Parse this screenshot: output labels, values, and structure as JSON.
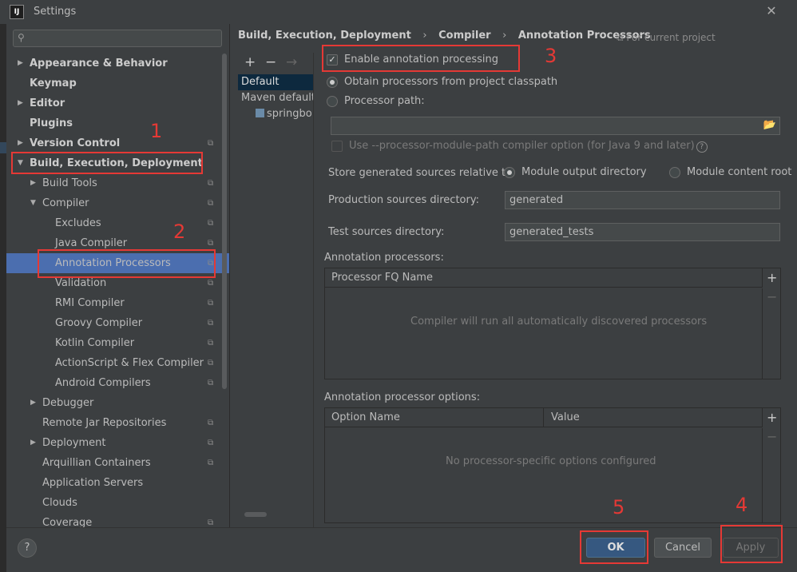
{
  "window": {
    "title": "Settings",
    "app_logo": "IJ"
  },
  "sidebar": {
    "search_placeholder": "",
    "items": [
      {
        "label": "Appearance & Behavior",
        "bold": true,
        "arrow": "right",
        "level": 0
      },
      {
        "label": "Keymap",
        "bold": true,
        "arrow": "",
        "level": 0
      },
      {
        "label": "Editor",
        "bold": true,
        "arrow": "right",
        "level": 0
      },
      {
        "label": "Plugins",
        "bold": true,
        "arrow": "",
        "level": 0
      },
      {
        "label": "Version Control",
        "bold": true,
        "arrow": "right",
        "level": 0,
        "project": true
      },
      {
        "label": "Build, Execution, Deployment",
        "bold": true,
        "arrow": "down",
        "level": 0
      },
      {
        "label": "Build Tools",
        "arrow": "right",
        "level": 1,
        "project": true
      },
      {
        "label": "Compiler",
        "arrow": "down",
        "level": 1,
        "project": true
      },
      {
        "label": "Excludes",
        "arrow": "",
        "level": 2,
        "project": true
      },
      {
        "label": "Java Compiler",
        "arrow": "",
        "level": 2,
        "project": true
      },
      {
        "label": "Annotation Processors",
        "arrow": "",
        "level": 2,
        "project": true,
        "selected": true
      },
      {
        "label": "Validation",
        "arrow": "",
        "level": 2,
        "project": true
      },
      {
        "label": "RMI Compiler",
        "arrow": "",
        "level": 2,
        "project": true
      },
      {
        "label": "Groovy Compiler",
        "arrow": "",
        "level": 2,
        "project": true
      },
      {
        "label": "Kotlin Compiler",
        "arrow": "",
        "level": 2,
        "project": true
      },
      {
        "label": "ActionScript & Flex Compiler",
        "arrow": "",
        "level": 2,
        "project": true
      },
      {
        "label": "Android Compilers",
        "arrow": "",
        "level": 2,
        "project": true
      },
      {
        "label": "Debugger",
        "arrow": "right",
        "level": 1
      },
      {
        "label": "Remote Jar Repositories",
        "arrow": "",
        "level": 1,
        "project": true
      },
      {
        "label": "Deployment",
        "arrow": "right",
        "level": 1,
        "project": true
      },
      {
        "label": "Arquillian Containers",
        "arrow": "",
        "level": 1,
        "project": true
      },
      {
        "label": "Application Servers",
        "arrow": "",
        "level": 1
      },
      {
        "label": "Clouds",
        "arrow": "",
        "level": 1
      },
      {
        "label": "Coverage",
        "arrow": "",
        "level": 1,
        "project": true
      }
    ]
  },
  "breadcrumb": {
    "part1": "Build, Execution, Deployment",
    "part2": "Compiler",
    "part3": "Annotation Processors",
    "separator": "›",
    "for_project": "For current project"
  },
  "profiles": {
    "add": "+",
    "remove": "−",
    "move": "→",
    "items": [
      "Default",
      "Maven default a",
      "springbo"
    ]
  },
  "settings": {
    "enable_label": "Enable annotation processing",
    "enable_checked": true,
    "obtain_label": "Obtain processors from project classpath",
    "processor_path_label": "Processor path:",
    "path_value": "",
    "module_path_label": "Use --processor-module-path compiler option (for Java 9 and later)",
    "store_label": "Store generated sources relative to:",
    "module_output": "Module output directory",
    "module_content": "Module content root",
    "prod_label": "Production sources directory:",
    "prod_value": "generated",
    "test_label": "Test sources directory:",
    "test_value": "generated_tests"
  },
  "processors_panel": {
    "title": "Annotation processors:",
    "column": "Processor FQ Name",
    "empty": "Compiler will run all automatically discovered processors"
  },
  "options_panel": {
    "title": "Annotation processor options:",
    "col_name": "Option Name",
    "col_value": "Value",
    "empty": "No processor-specific options configured"
  },
  "buttons": {
    "ok": "OK",
    "cancel": "Cancel",
    "apply": "Apply",
    "help": "?"
  },
  "annotations": [
    "1",
    "2",
    "3",
    "4",
    "5"
  ],
  "colors": {
    "selection": "#4b6eaf",
    "annotation_red": "#e53935",
    "ok_button": "#365880"
  }
}
